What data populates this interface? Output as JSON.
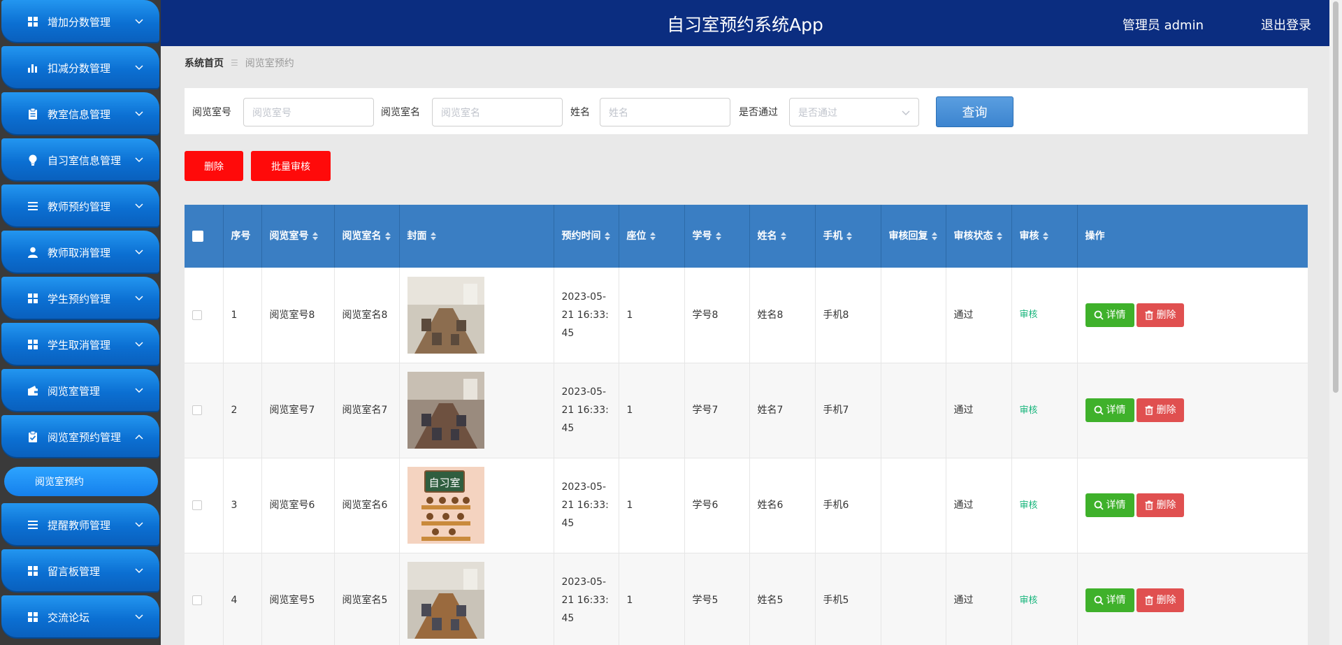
{
  "header": {
    "title": "自习室预约系统App",
    "user": "管理员 admin",
    "logout": "退出登录"
  },
  "sidebar": {
    "items": [
      {
        "label": "增加分数管理",
        "icon": "grid-icon",
        "expanded": false
      },
      {
        "label": "扣减分数管理",
        "icon": "bar-chart-icon",
        "expanded": false
      },
      {
        "label": "教室信息管理",
        "icon": "clipboard-icon",
        "expanded": false
      },
      {
        "label": "自习室信息管理",
        "icon": "lightbulb-icon",
        "expanded": false
      },
      {
        "label": "教师预约管理",
        "icon": "list-icon",
        "expanded": false
      },
      {
        "label": "教师取消管理",
        "icon": "user-icon",
        "expanded": false
      },
      {
        "label": "学生预约管理",
        "icon": "grid-icon",
        "expanded": false
      },
      {
        "label": "学生取消管理",
        "icon": "grid-icon",
        "expanded": false
      },
      {
        "label": "阅览室管理",
        "icon": "wallet-icon",
        "expanded": false
      },
      {
        "label": "阅览室预约管理",
        "icon": "clipboard-check-icon",
        "expanded": true
      },
      {
        "label": "提醒教师管理",
        "icon": "list-icon",
        "expanded": false
      },
      {
        "label": "留言板管理",
        "icon": "grid-icon",
        "expanded": false
      },
      {
        "label": "交流论坛",
        "icon": "grid-icon",
        "expanded": false
      }
    ],
    "sub_item": "阅览室预约"
  },
  "breadcrumb": {
    "home": "系统首页",
    "current": "阅览室预约"
  },
  "search": {
    "room_no_label": "阅览室号",
    "room_no_placeholder": "阅览室号",
    "room_name_label": "阅览室名",
    "room_name_placeholder": "阅览室名",
    "name_label": "姓名",
    "name_placeholder": "姓名",
    "passed_label": "是否通过",
    "passed_placeholder": "是否通过",
    "query_button": "查询"
  },
  "actions": {
    "delete": "删除",
    "batch_audit": "批量审核"
  },
  "table": {
    "headers": [
      "序号",
      "阅览室号",
      "阅览室名",
      "封面",
      "预约时间",
      "座位",
      "学号",
      "姓名",
      "手机",
      "审核回复",
      "审核状态",
      "审核",
      "操作"
    ],
    "rows": [
      {
        "index": "1",
        "room_no": "阅览室号8",
        "room_name": "阅览室名8",
        "cover": "study-room-photo-1",
        "time": "2023-05-21 16:33:45",
        "seat": "1",
        "student_no": "学号8",
        "name": "姓名8",
        "phone": "手机8",
        "reply": "",
        "status": "通过",
        "audit": "审核"
      },
      {
        "index": "2",
        "room_no": "阅览室号7",
        "room_name": "阅览室名7",
        "cover": "study-room-photo-2",
        "time": "2023-05-21 16:33:45",
        "seat": "1",
        "student_no": "学号7",
        "name": "姓名7",
        "phone": "手机7",
        "reply": "",
        "status": "通过",
        "audit": "审核"
      },
      {
        "index": "3",
        "room_no": "阅览室号6",
        "room_name": "阅览室名6",
        "cover": "study-room-illustration",
        "time": "2023-05-21 16:33:45",
        "seat": "1",
        "student_no": "学号6",
        "name": "姓名6",
        "phone": "手机6",
        "reply": "",
        "status": "通过",
        "audit": "审核"
      },
      {
        "index": "4",
        "room_no": "阅览室号5",
        "room_name": "阅览室名5",
        "cover": "study-room-photo-3",
        "time": "2023-05-21 16:33:45",
        "seat": "1",
        "student_no": "学号5",
        "name": "姓名5",
        "phone": "手机5",
        "reply": "",
        "status": "通过",
        "audit": "审核"
      }
    ],
    "detail_button": "详情",
    "delete_button": "删除",
    "illustration_text": "自习室"
  },
  "colors": {
    "header_bg": "#0b2d80",
    "table_header_bg": "#3a7ec3",
    "delete_red": "#ff0a0a",
    "detail_green": "#3fb12b",
    "audit_green": "#15b47a"
  }
}
